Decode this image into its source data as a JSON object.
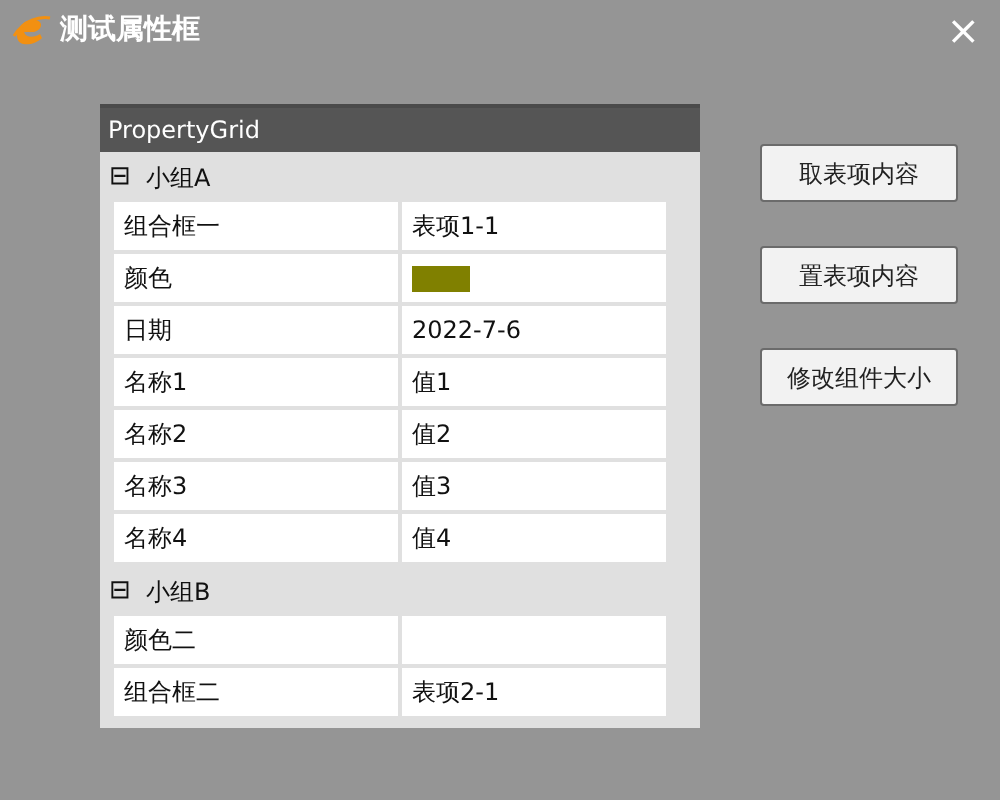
{
  "window": {
    "title": "测试属性框",
    "close": "×"
  },
  "grid": {
    "title": "PropertyGrid",
    "groups": [
      {
        "name": "小组A",
        "toggle": "⊟",
        "expanded": true,
        "rows": [
          {
            "kind": "text",
            "name": "组合框一",
            "value": "表项1-1"
          },
          {
            "kind": "color",
            "name": "颜色",
            "color": "#808000"
          },
          {
            "kind": "text",
            "name": "日期",
            "value": "2022-7-6"
          },
          {
            "kind": "text",
            "name": "名称1",
            "value": "值1"
          },
          {
            "kind": "text",
            "name": "名称2",
            "value": "值2"
          },
          {
            "kind": "text",
            "name": "名称3",
            "value": "值3"
          },
          {
            "kind": "text",
            "name": "名称4",
            "value": "值4"
          }
        ]
      },
      {
        "name": "小组B",
        "toggle": "⊟",
        "expanded": true,
        "rows": [
          {
            "kind": "text",
            "name": "颜色二"
          },
          {
            "kind": "text",
            "name": "组合框二",
            "value": "表项2-1"
          }
        ]
      }
    ]
  },
  "buttons": [
    "取表项内容",
    "置表项内容",
    "修改组件大小"
  ]
}
